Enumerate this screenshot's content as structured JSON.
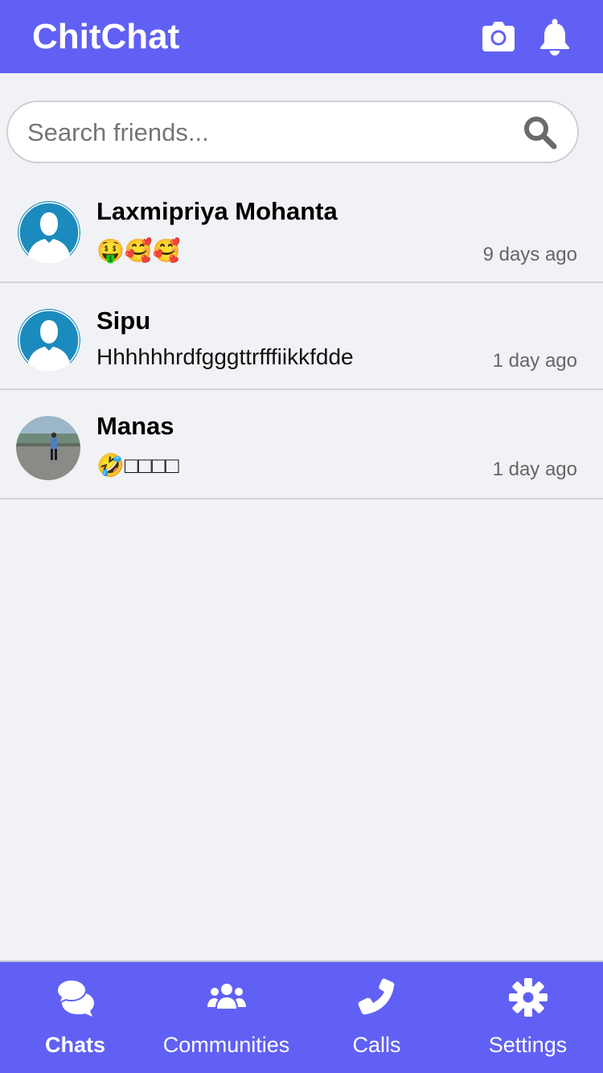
{
  "header": {
    "title": "ChitChat",
    "camera_icon": "camera-icon",
    "bell_icon": "bell-icon"
  },
  "search": {
    "placeholder": "Search friends...",
    "value": "",
    "icon": "search-icon"
  },
  "chats": [
    {
      "name": "Laxmipriya Mohanta",
      "message": "🤑🥰🥰",
      "time": "9 days ago",
      "avatar": "default-avatar"
    },
    {
      "name": "Sipu",
      "message": "Hhhhhhrdfgggttrfffiikkfdde",
      "time": "1 day ago",
      "avatar": "default-avatar"
    },
    {
      "name": "Manas",
      "message": "🤣□□□□",
      "time": "1 day ago",
      "avatar": "photo-avatar"
    }
  ],
  "nav": {
    "items": [
      {
        "label": "Chats",
        "icon": "chats-icon",
        "active": true
      },
      {
        "label": "Communities",
        "icon": "communities-icon",
        "active": false
      },
      {
        "label": "Calls",
        "icon": "phone-icon",
        "active": false
      },
      {
        "label": "Settings",
        "icon": "gear-icon",
        "active": false
      }
    ]
  },
  "colors": {
    "primary": "#6060f5",
    "background": "#f0f2f5",
    "avatar_blue": "#1b8bbd",
    "divider": "#d2d3d8"
  }
}
